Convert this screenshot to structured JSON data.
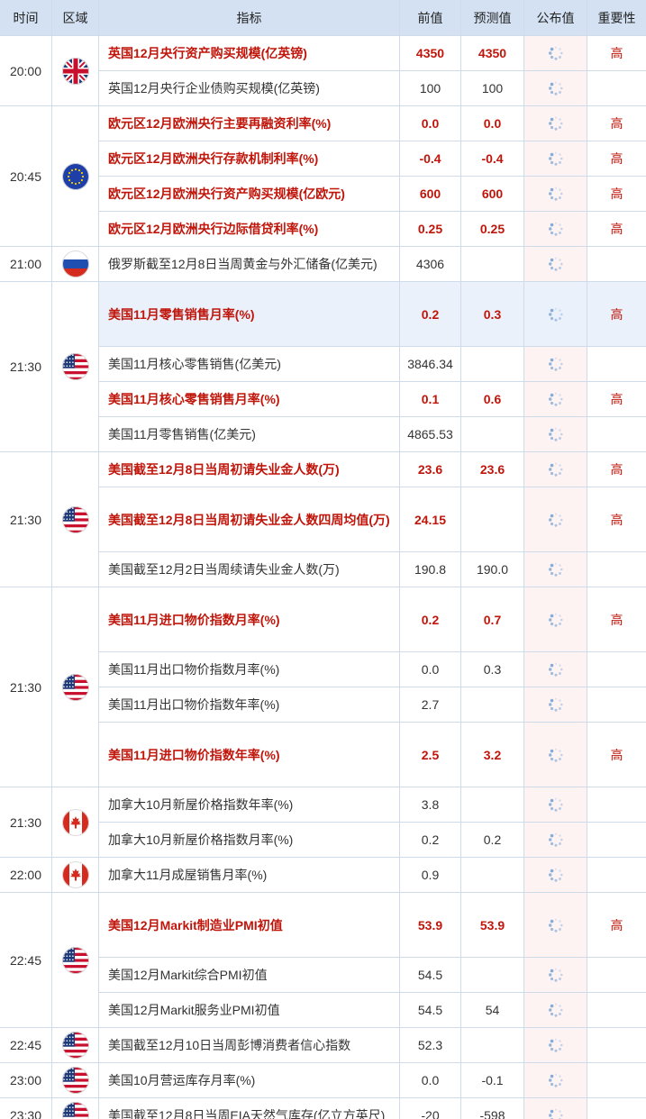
{
  "header": {
    "time": "时间",
    "region": "区域",
    "indicator": "指标",
    "previous": "前值",
    "forecast": "预测值",
    "published": "公布值",
    "importance": "重要性"
  },
  "colors": {
    "header_bg": "#d3e1f3",
    "high_text": "#c0150a",
    "grid_line": "#cfdbe8",
    "published_bg": "#fdf3f3",
    "selected_row_bg": "#eaf1fb",
    "spinner": "#7fa9d6"
  },
  "groups": [
    {
      "time": "20:00",
      "flag": "uk-flag-icon",
      "rows": [
        {
          "indicator": "英国12月央行资产购买规模(亿英镑)",
          "previous": "4350",
          "forecast": "4350",
          "importance": "高",
          "high": true
        },
        {
          "indicator": "英国12月央行企业债购买规模(亿英镑)",
          "previous": "100",
          "forecast": "100",
          "importance": "",
          "high": false
        }
      ]
    },
    {
      "time": "20:45",
      "flag": "eu-flag-icon",
      "rows": [
        {
          "indicator": "欧元区12月欧洲央行主要再融资利率(%)",
          "previous": "0.0",
          "forecast": "0.0",
          "importance": "高",
          "high": true
        },
        {
          "indicator": "欧元区12月欧洲央行存款机制利率(%)",
          "previous": "-0.4",
          "forecast": "-0.4",
          "importance": "高",
          "high": true
        },
        {
          "indicator": "欧元区12月欧洲央行资产购买规模(亿欧元)",
          "previous": "600",
          "forecast": "600",
          "importance": "高",
          "high": true
        },
        {
          "indicator": "欧元区12月欧洲央行边际借贷利率(%)",
          "previous": "0.25",
          "forecast": "0.25",
          "importance": "高",
          "high": true
        }
      ]
    },
    {
      "time": "21:00",
      "flag": "russia-flag-icon",
      "rows": [
        {
          "indicator": "俄罗斯截至12月8日当周黄金与外汇储备(亿美元)",
          "previous": "4306",
          "forecast": "",
          "importance": "",
          "high": false
        }
      ]
    },
    {
      "time": "21:30",
      "flag": "us-flag-icon",
      "rows": [
        {
          "indicator": "美国11月零售销售月率(%)",
          "previous": "0.2",
          "forecast": "0.3",
          "importance": "高",
          "high": true,
          "selected": true
        },
        {
          "indicator": "美国11月核心零售销售(亿美元)",
          "previous": "3846.34",
          "forecast": "",
          "importance": "",
          "high": false
        },
        {
          "indicator": "美国11月核心零售销售月率(%)",
          "previous": "0.1",
          "forecast": "0.6",
          "importance": "高",
          "high": true
        },
        {
          "indicator": "美国11月零售销售(亿美元)",
          "previous": "4865.53",
          "forecast": "",
          "importance": "",
          "high": false
        }
      ]
    },
    {
      "time": "21:30",
      "flag": "us-flag-icon",
      "rows": [
        {
          "indicator": "美国截至12月8日当周初请失业金人数(万)",
          "previous": "23.6",
          "forecast": "23.6",
          "importance": "高",
          "high": true
        },
        {
          "indicator": "美国截至12月8日当周初请失业金人数四周均值(万)",
          "previous": "24.15",
          "forecast": "",
          "importance": "高",
          "high": true
        },
        {
          "indicator": "美国截至12月2日当周续请失业金人数(万)",
          "previous": "190.8",
          "forecast": "190.0",
          "importance": "",
          "high": false
        }
      ]
    },
    {
      "time": "21:30",
      "flag": "us-flag-icon",
      "rows": [
        {
          "indicator": "美国11月进口物价指数月率(%)",
          "previous": "0.2",
          "forecast": "0.7",
          "importance": "高",
          "high": true
        },
        {
          "indicator": "美国11月出口物价指数月率(%)",
          "previous": "0.0",
          "forecast": "0.3",
          "importance": "",
          "high": false
        },
        {
          "indicator": "美国11月出口物价指数年率(%)",
          "previous": "2.7",
          "forecast": "",
          "importance": "",
          "high": false
        },
        {
          "indicator": "美国11月进口物价指数年率(%)",
          "previous": "2.5",
          "forecast": "3.2",
          "importance": "高",
          "high": true
        }
      ]
    },
    {
      "time": "21:30",
      "flag": "canada-flag-icon",
      "rows": [
        {
          "indicator": "加拿大10月新屋价格指数年率(%)",
          "previous": "3.8",
          "forecast": "",
          "importance": "",
          "high": false
        },
        {
          "indicator": "加拿大10月新屋价格指数月率(%)",
          "previous": "0.2",
          "forecast": "0.2",
          "importance": "",
          "high": false
        }
      ]
    },
    {
      "time": "22:00",
      "flag": "canada-flag-icon",
      "rows": [
        {
          "indicator": "加拿大11月成屋销售月率(%)",
          "previous": "0.9",
          "forecast": "",
          "importance": "",
          "high": false
        }
      ]
    },
    {
      "time": "22:45",
      "flag": "us-flag-icon",
      "rows": [
        {
          "indicator": "美国12月Markit制造业PMI初值",
          "previous": "53.9",
          "forecast": "53.9",
          "importance": "高",
          "high": true
        },
        {
          "indicator": "美国12月Markit综合PMI初值",
          "previous": "54.5",
          "forecast": "",
          "importance": "",
          "high": false
        },
        {
          "indicator": "美国12月Markit服务业PMI初值",
          "previous": "54.5",
          "forecast": "54",
          "importance": "",
          "high": false
        }
      ]
    },
    {
      "time": "22:45",
      "flag": "us-flag-icon",
      "rows": [
        {
          "indicator": "美国截至12月10日当周彭博消费者信心指数",
          "previous": "52.3",
          "forecast": "",
          "importance": "",
          "high": false
        }
      ]
    },
    {
      "time": "23:00",
      "flag": "us-flag-icon",
      "rows": [
        {
          "indicator": "美国10月营运库存月率(%)",
          "previous": "0.0",
          "forecast": "-0.1",
          "importance": "",
          "high": false
        }
      ]
    },
    {
      "time": "23:30",
      "flag": "us-flag-icon",
      "rows": [
        {
          "indicator": "美国截至12月8日当周EIA天然气库存(亿立方英尺)",
          "previous": "-20",
          "forecast": "-598",
          "importance": "",
          "high": false
        }
      ]
    }
  ]
}
